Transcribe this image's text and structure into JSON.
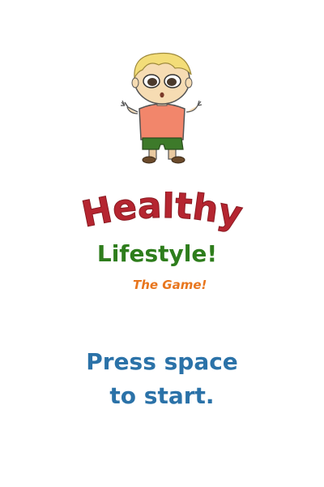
{
  "game": {
    "title": "Healthy",
    "subtitle": "Lifestyle!",
    "tagline": "The Game!",
    "prompt_line1": "Press space",
    "prompt_line2": "to start."
  },
  "colors": {
    "background": "#ffffff",
    "title": "#b52530",
    "subtitle": "#2e7d1c",
    "tagline": "#e8761e",
    "prompt": "#2b72a8"
  },
  "mascot": {
    "icon": "cartoon-child-mascot-icon"
  }
}
